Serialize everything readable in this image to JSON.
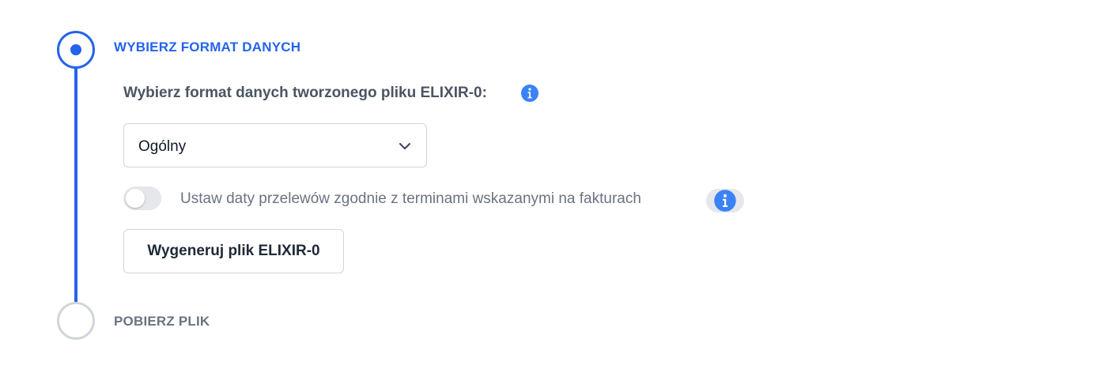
{
  "steps": [
    {
      "title": "WYBIERZ FORMAT DANYCH",
      "state": "active"
    },
    {
      "title": "POBIERZ PLIK",
      "state": "inactive"
    }
  ],
  "format": {
    "label": "Wybierz format danych tworzonego pliku ELIXIR-0:",
    "info_icon": "info-circle-icon",
    "selected_value": "Ogólny",
    "chevron_icon": "chevron-down-icon"
  },
  "toggle": {
    "label": "Ustaw daty przelewów zgodnie z terminami wskazanymi na fakturach",
    "checked": false,
    "info_icon": "info-circle-icon"
  },
  "actions": {
    "generate_label": "Wygeneruj plik ELIXIR-0"
  },
  "colors": {
    "accent": "#2563eb",
    "info": "#3b82f6",
    "inactive": "#d1d5db",
    "text_muted": "#6b7280"
  }
}
